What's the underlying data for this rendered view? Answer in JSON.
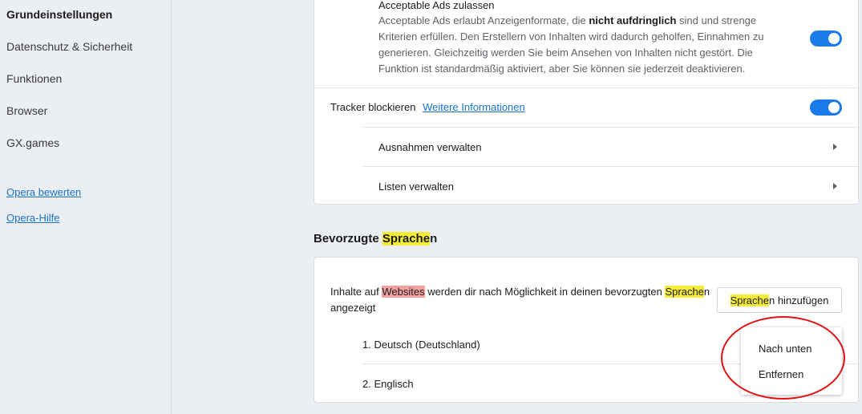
{
  "sidebar": {
    "items": [
      {
        "label": "Grundeinstellungen"
      },
      {
        "label": "Datenschutz & Sicherheit"
      },
      {
        "label": "Funktionen"
      },
      {
        "label": "Browser"
      },
      {
        "label": "GX.games"
      }
    ],
    "links": [
      {
        "label": "Opera bewerten"
      },
      {
        "label": "Opera-Hilfe"
      }
    ]
  },
  "ads": {
    "title": "Acceptable Ads zulassen",
    "desc_1": "Acceptable Ads erlaubt Anzeigenformate, die ",
    "desc_bold": "nicht aufdringlich",
    "desc_2": " sind und strenge Kriterien erfüllen. Den Erstellern von Inhalten wird dadurch geholfen, Einnahmen zu generieren. Gleichzeitig werden Sie beim Ansehen von Inhalten nicht gestört. Die Funktion ist standardmäßig aktiviert, aber Sie können sie jederzeit deaktivieren.",
    "toggle_on": true
  },
  "tracker": {
    "label": "Tracker blockieren",
    "link": "Weitere Informationen",
    "toggle_on": true,
    "rows": [
      {
        "label": "Ausnahmen verwalten"
      },
      {
        "label": "Listen verwalten"
      }
    ]
  },
  "languages": {
    "title_pre": "Bevorzugte ",
    "title_hl": "Sprache",
    "title_post": "n",
    "desc_1": "Inhalte au",
    "desc_2": "f ",
    "desc_hl_red": "Websites",
    "desc_3": " werden dir nach Möglichkeit in deinen bevorzugten ",
    "desc_hl": "Sprache",
    "desc_4": "n",
    "desc_line2": "angezeigt",
    "button_hl": "Sprache",
    "button_rest": "n hinzufügen",
    "list": [
      {
        "label": "1. Deutsch (Deutschland)"
      },
      {
        "label": "2. Englisch"
      }
    ],
    "menu": [
      {
        "label": "Nach unten"
      },
      {
        "label": "Entfernen"
      }
    ]
  },
  "colors": {
    "accent": "#1a7be8",
    "highlight_yellow": "#f5ec3a",
    "highlight_red": "#f2a1a1",
    "annotation_red": "#e01010"
  }
}
